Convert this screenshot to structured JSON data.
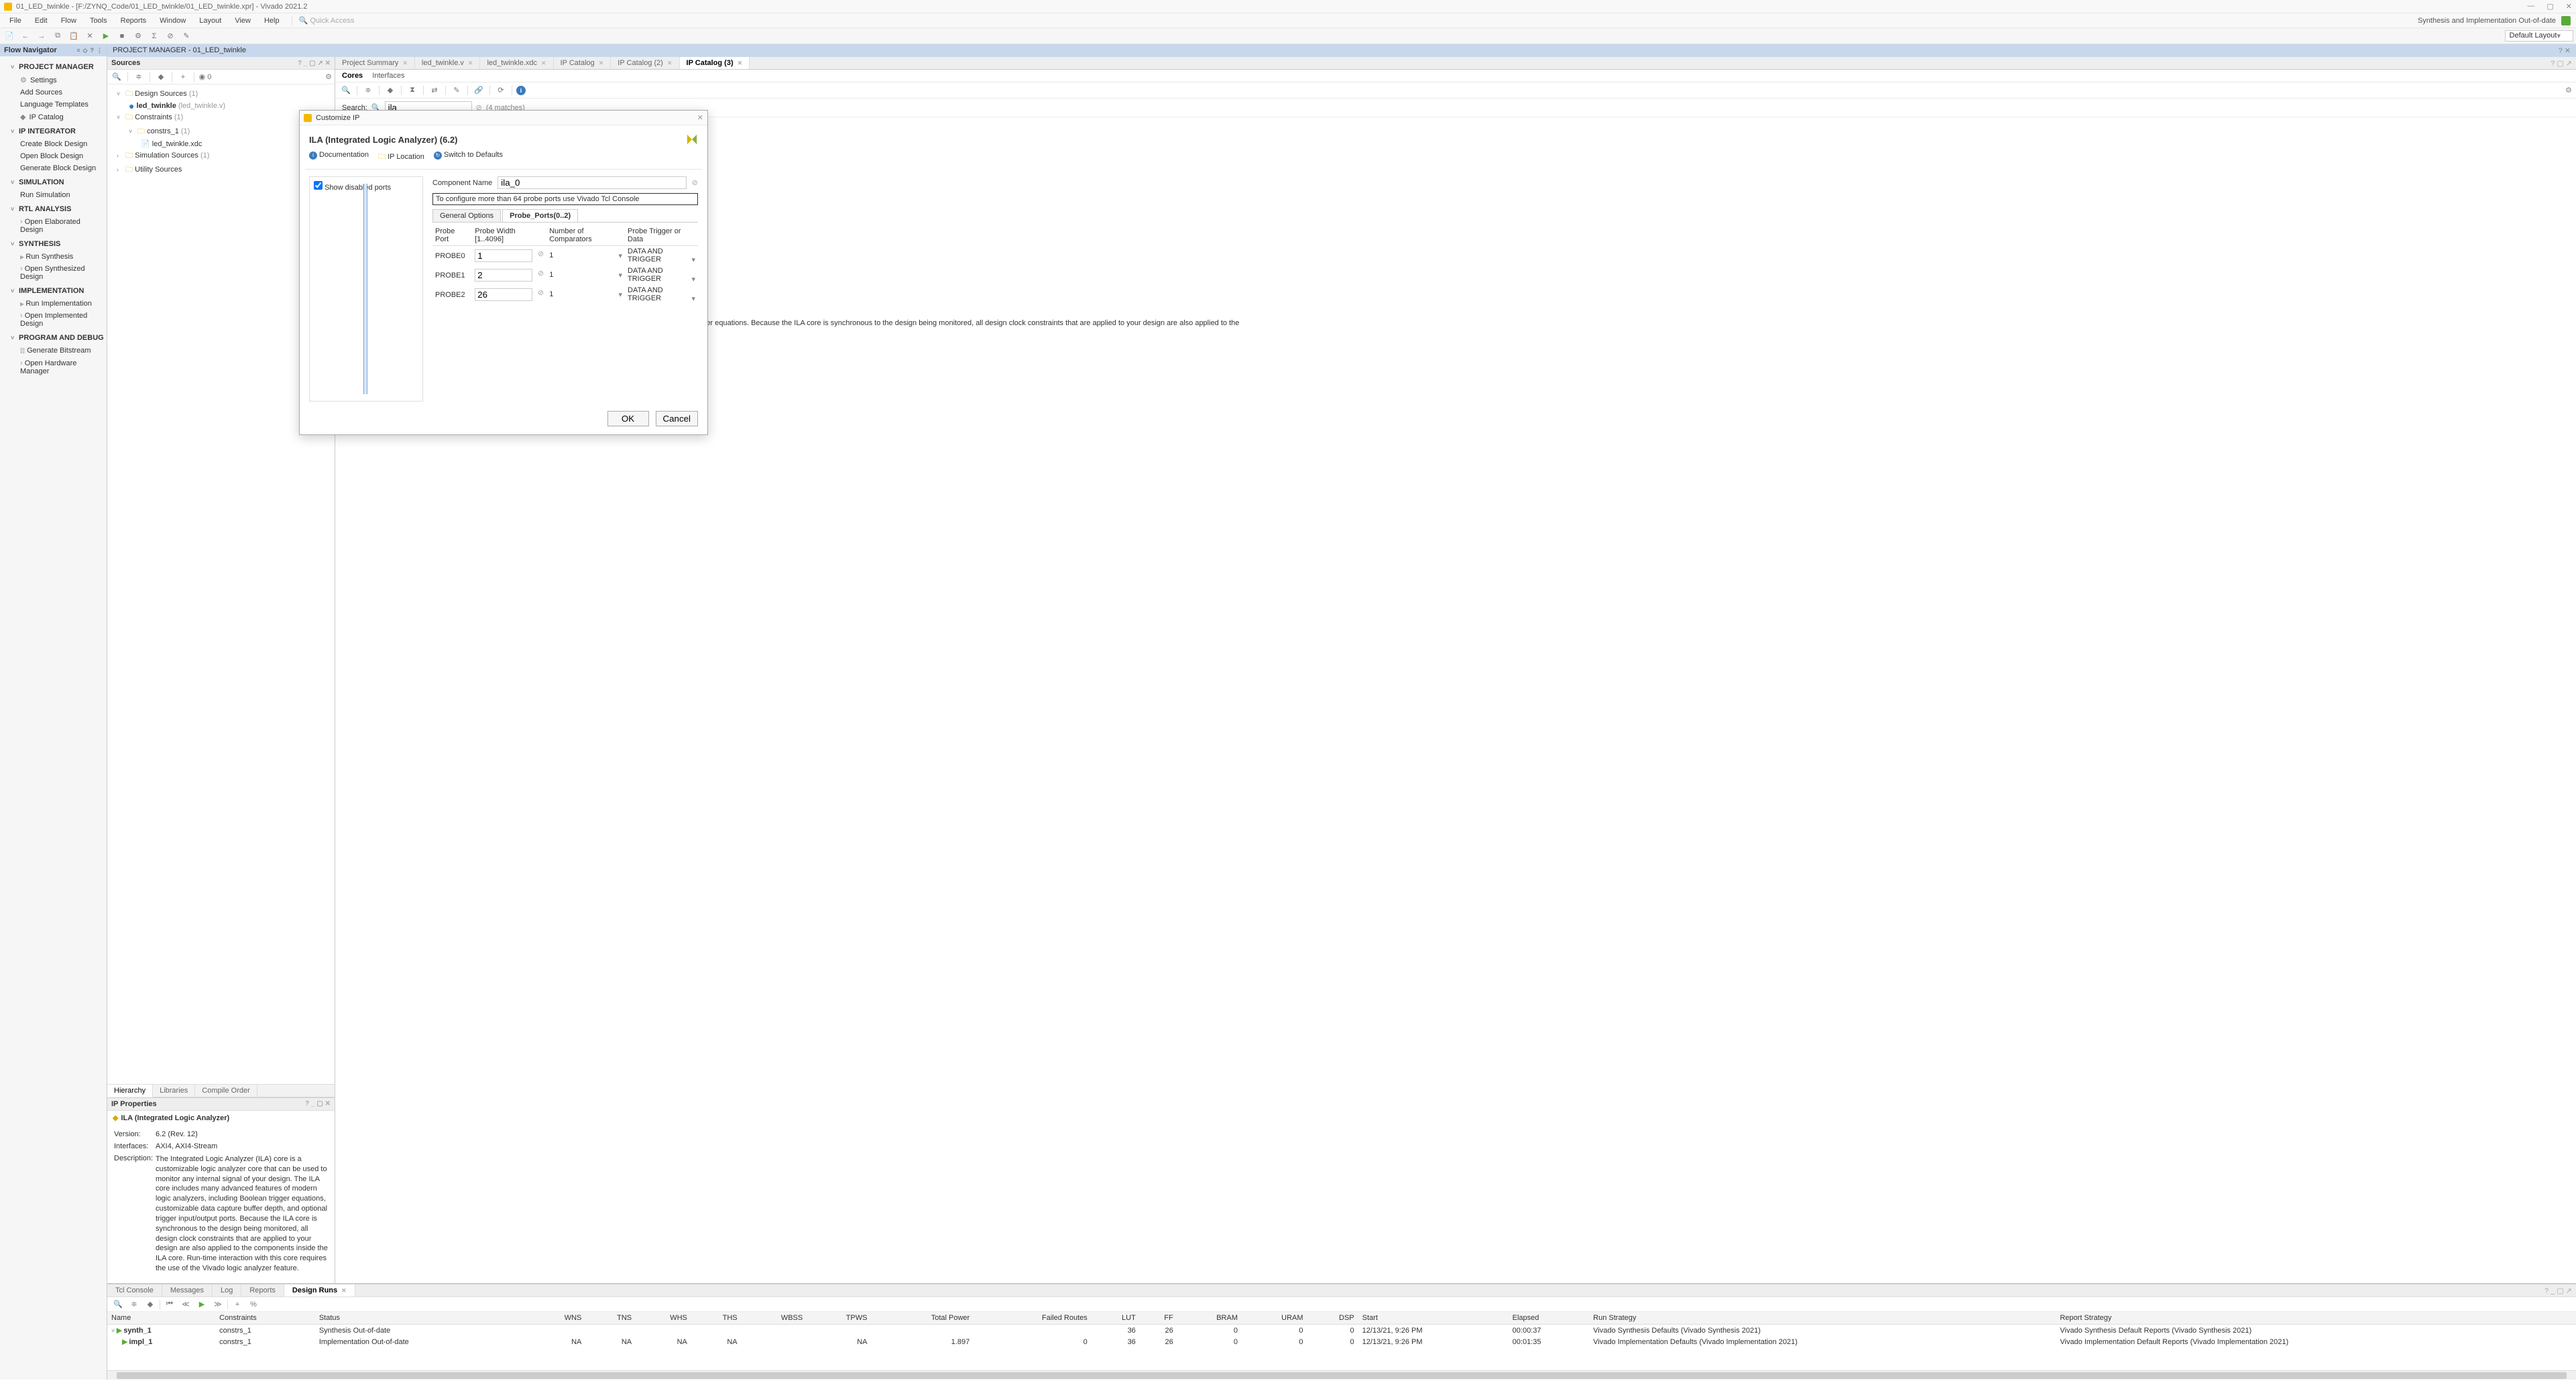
{
  "window": {
    "title": "01_LED_twinkle - [F:/ZYNQ_Code/01_LED_twinkle/01_LED_twinkle.xpr] - Vivado 2021.2",
    "status_right": "Synthesis and Implementation Out-of-date",
    "layout": "Default Layout"
  },
  "menu": {
    "items": [
      "File",
      "Edit",
      "Flow",
      "Tools",
      "Reports",
      "Window",
      "Layout",
      "View",
      "Help"
    ],
    "quick_access": "Quick Access"
  },
  "flow_navigator": {
    "title": "Flow Navigator",
    "sections": {
      "pm": {
        "title": "PROJECT MANAGER",
        "items": [
          "Settings",
          "Add Sources",
          "Language Templates",
          "IP Catalog"
        ]
      },
      "ipi": {
        "title": "IP INTEGRATOR",
        "items": [
          "Create Block Design",
          "Open Block Design",
          "Generate Block Design"
        ]
      },
      "sim": {
        "title": "SIMULATION",
        "items": [
          "Run Simulation"
        ]
      },
      "rtl": {
        "title": "RTL ANALYSIS",
        "items": [
          "Open Elaborated Design"
        ]
      },
      "syn": {
        "title": "SYNTHESIS",
        "items": [
          "Run Synthesis",
          "Open Synthesized Design"
        ]
      },
      "impl": {
        "title": "IMPLEMENTATION",
        "items": [
          "Run Implementation",
          "Open Implemented Design"
        ]
      },
      "pd": {
        "title": "PROGRAM AND DEBUG",
        "items": [
          "Generate Bitstream",
          "Open Hardware Manager"
        ]
      }
    }
  },
  "project_manager_header": "PROJECT MANAGER - 01_LED_twinkle",
  "sources": {
    "title": "Sources",
    "design_sources": {
      "label": "Design Sources",
      "count": "(1)",
      "items": [
        {
          "name": "led_twinkle",
          "file": "(led_twinkle.v)"
        }
      ]
    },
    "constraints": {
      "label": "Constraints",
      "count": "(1)",
      "set": {
        "name": "constrs_1",
        "count": "(1)",
        "file": "led_twinkle.xdc"
      }
    },
    "sim_sources": {
      "label": "Simulation Sources",
      "count": "(1)"
    },
    "util_sources": {
      "label": "Utility Sources"
    },
    "subtabs": {
      "hierarchy": "Hierarchy",
      "libraries": "Libraries",
      "compile": "Compile Order"
    }
  },
  "ip_properties": {
    "title": "IP Properties",
    "name": "ILA (Integrated Logic Analyzer)",
    "version_k": "Version:",
    "version_v": "6.2 (Rev. 12)",
    "interfaces_k": "Interfaces:",
    "interfaces_v": "AXI4, AXI4-Stream",
    "description_k": "Description:",
    "description_v": "The Integrated Logic Analyzer (ILA) core is a customizable logic analyzer core that can be used to monitor any internal signal of your design. The ILA core includes many advanced features of modern logic analyzers, including Boolean trigger equations, customizable data capture buffer depth, and optional trigger input/output ports. Because the ILA core is synchronous to the design being monitored, all design clock constraints that are applied to your design are also applied to the components inside the ILA core. Run-time interaction with this core requires the use of the Vivado logic analyzer feature."
  },
  "doc_tabs": [
    "Project Summary",
    "led_twinkle.v",
    "led_twinkle.xdc",
    "IP Catalog",
    "IP Catalog (2)",
    "IP Catalog (3)"
  ],
  "ipc": {
    "sub_cores": "Cores",
    "sub_interfaces": "Interfaces",
    "search_label": "Search:",
    "search_value": "ila",
    "matches": "(4 matches)",
    "desc_frag": "design. The ILA core includes many advanced features of modern logic analyzers, including Boolean trigger equations. Because the ILA core is synchronous to the design being monitored, all design clock constraints that are applied to your design are also applied to the"
  },
  "dialog": {
    "window_title": "Customize IP",
    "title": "ILA (Integrated Logic Analyzer) (6.2)",
    "link_doc": "Documentation",
    "link_loc": "IP Location",
    "link_def": "Switch to Defaults",
    "show_disabled": "Show disabled ports",
    "comp_name_label": "Component Name",
    "comp_name_value": "ila_0",
    "note": "To configure more than 64 probe ports use Vivado Tcl Console",
    "tab_general": "General Options",
    "tab_probe": "Probe_Ports(0..2)",
    "cols": {
      "port": "Probe Port",
      "width": "Probe Width [1..4096]",
      "comp": "Number of Comparators",
      "trig": "Probe Trigger or Data"
    },
    "rows": [
      {
        "port": "PROBE0",
        "width": "1",
        "comp": "1",
        "trig": "DATA AND TRIGGER"
      },
      {
        "port": "PROBE1",
        "width": "2",
        "comp": "1",
        "trig": "DATA AND TRIGGER"
      },
      {
        "port": "PROBE2",
        "width": "26",
        "comp": "1",
        "trig": "DATA AND TRIGGER"
      }
    ],
    "ok": "OK",
    "cancel": "Cancel"
  },
  "bottom_tabs": {
    "tcl": "Tcl Console",
    "msg": "Messages",
    "log": "Log",
    "rep": "Reports",
    "runs": "Design Runs"
  },
  "runs": {
    "headers": [
      "Name",
      "Constraints",
      "Status",
      "WNS",
      "TNS",
      "WHS",
      "THS",
      "WBSS",
      "TPWS",
      "Total Power",
      "Failed Routes",
      "LUT",
      "FF",
      "BRAM",
      "URAM",
      "DSP",
      "Start",
      "Elapsed",
      "Run Strategy",
      "Report Strategy"
    ],
    "rows": [
      {
        "name": "synth_1",
        "constraints": "constrs_1",
        "status": "Synthesis Out-of-date",
        "wns": "",
        "tns": "",
        "whs": "",
        "ths": "",
        "wbss": "",
        "tpws": "",
        "tp": "",
        "fr": "",
        "lut": "36",
        "ff": "26",
        "bram": "0",
        "uram": "0",
        "dsp": "0",
        "start": "12/13/21, 9:26 PM",
        "elapsed": "00:00:37",
        "strategy": "Vivado Synthesis Defaults (Vivado Synthesis 2021)",
        "report": "Vivado Synthesis Default Reports (Vivado Synthesis 2021)"
      },
      {
        "name": "impl_1",
        "constraints": "constrs_1",
        "status": "Implementation Out-of-date",
        "wns": "NA",
        "tns": "NA",
        "whs": "NA",
        "ths": "NA",
        "wbss": "",
        "tpws": "NA",
        "tp": "1.897",
        "fr": "0",
        "lut": "36",
        "ff": "26",
        "bram": "0",
        "uram": "0",
        "dsp": "0",
        "start": "12/13/21, 9:26 PM",
        "elapsed": "00:01:35",
        "strategy": "Vivado Implementation Defaults (Vivado Implementation 2021)",
        "report": "Vivado Implementation Default Reports (Vivado Implementation 2021)"
      }
    ]
  }
}
